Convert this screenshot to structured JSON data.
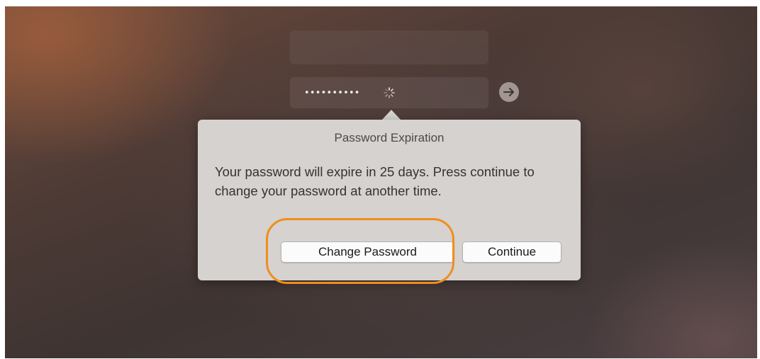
{
  "login": {
    "password_masked": "••••••••••",
    "go_icon": "arrow-right-icon",
    "spinner_icon": "spinner-icon"
  },
  "dialog": {
    "title": "Password Expiration",
    "message": "Your password will expire in 25 days. Press continue to change your password at another time.",
    "buttons": {
      "change_password": "Change Password",
      "continue": "Continue"
    }
  },
  "annotation": {
    "highlight_color": "#ef8e1c",
    "highlight_target": "change-password-button"
  }
}
